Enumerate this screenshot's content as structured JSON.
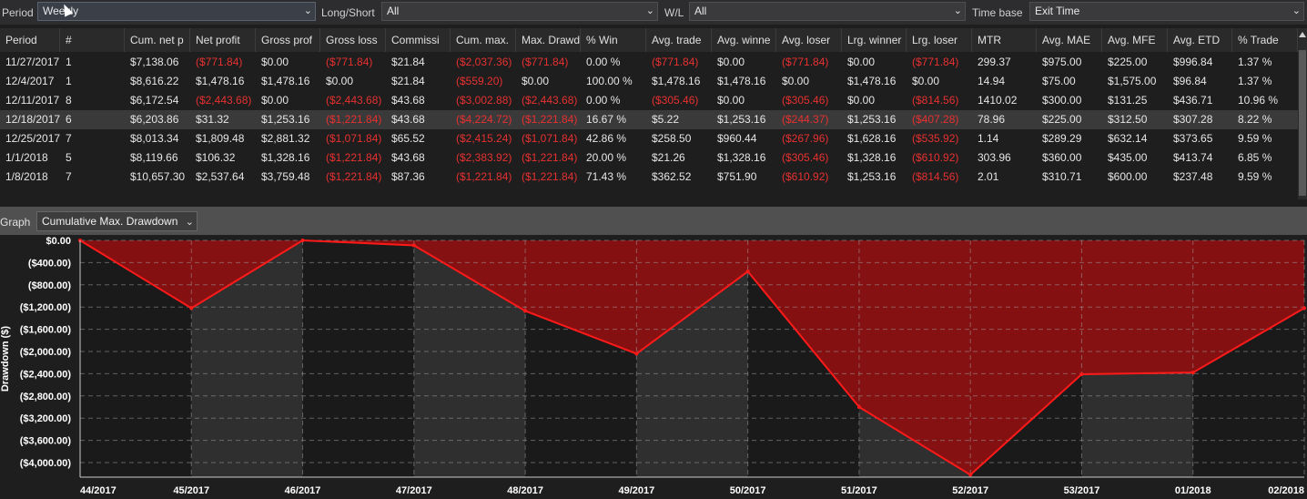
{
  "filters": {
    "period_label": "Period",
    "period_value": "Weekly",
    "longshort_label": "Long/Short",
    "longshort_value": "All",
    "wl_label": "W/L",
    "wl_value": "All",
    "timebase_label": "Time base",
    "timebase_value": "Exit Time"
  },
  "table": {
    "columns": [
      "Period",
      "#",
      "Cum. net p",
      "Net profit",
      "Gross prof",
      "Gross loss",
      "Commissi",
      "Cum. max.",
      "Max. Drawd",
      "% Win",
      "Avg. trade",
      "Avg. winne",
      "Avg. loser",
      "Lrg. winner",
      "Lrg. loser",
      "MTR",
      "Avg. MAE",
      "Avg. MFE",
      "Avg. ETD",
      "% Trade"
    ],
    "rows": [
      [
        "11/27/2017",
        "1",
        "$7,138.06",
        "($771.84)",
        "$0.00",
        "($771.84)",
        "$21.84",
        "($2,037.36)",
        "($771.84)",
        "0.00 %",
        "($771.84)",
        "$0.00",
        "($771.84)",
        "$0.00",
        "($771.84)",
        "299.37",
        "$975.00",
        "$225.00",
        "$996.84",
        "1.37 %"
      ],
      [
        "12/4/2017",
        "1",
        "$8,616.22",
        "$1,478.16",
        "$1,478.16",
        "$0.00",
        "$21.84",
        "($559.20)",
        "$0.00",
        "100.00 %",
        "$1,478.16",
        "$1,478.16",
        "$0.00",
        "$1,478.16",
        "$0.00",
        "14.94",
        "$75.00",
        "$1,575.00",
        "$96.84",
        "1.37 %"
      ],
      [
        "12/11/2017",
        "8",
        "$6,172.54",
        "($2,443.68)",
        "$0.00",
        "($2,443.68)",
        "$43.68",
        "($3,002.88)",
        "($2,443.68)",
        "0.00 %",
        "($305.46)",
        "$0.00",
        "($305.46)",
        "$0.00",
        "($814.56)",
        "1410.02",
        "$300.00",
        "$131.25",
        "$436.71",
        "10.96 %"
      ],
      [
        "12/18/2017",
        "6",
        "$6,203.86",
        "$31.32",
        "$1,253.16",
        "($1,221.84)",
        "$43.68",
        "($4,224.72)",
        "($1,221.84)",
        "16.67 %",
        "$5.22",
        "$1,253.16",
        "($244.37)",
        "$1,253.16",
        "($407.28)",
        "78.96",
        "$225.00",
        "$312.50",
        "$307.28",
        "8.22 %"
      ],
      [
        "12/25/2017",
        "7",
        "$8,013.34",
        "$1,809.48",
        "$2,881.32",
        "($1,071.84)",
        "$65.52",
        "($2,415.24)",
        "($1,071.84)",
        "42.86 %",
        "$258.50",
        "$960.44",
        "($267.96)",
        "$1,628.16",
        "($535.92)",
        "1.14",
        "$289.29",
        "$632.14",
        "$373.65",
        "9.59 %"
      ],
      [
        "1/1/2018",
        "5",
        "$8,119.66",
        "$106.32",
        "$1,328.16",
        "($1,221.84)",
        "$43.68",
        "($2,383.92)",
        "($1,221.84)",
        "20.00 %",
        "$21.26",
        "$1,328.16",
        "($305.46)",
        "$1,328.16",
        "($610.92)",
        "303.96",
        "$360.00",
        "$435.00",
        "$413.74",
        "6.85 %"
      ],
      [
        "1/8/2018",
        "7",
        "$10,657.30",
        "$2,537.64",
        "$3,759.48",
        "($1,221.84)",
        "$87.36",
        "($1,221.84)",
        "($1,221.84)",
        "71.43 %",
        "$362.52",
        "$751.90",
        "($610.92)",
        "$1,253.16",
        "($814.56)",
        "2.01",
        "$310.71",
        "$600.00",
        "$237.48",
        "9.59 %"
      ]
    ]
  },
  "graph": {
    "label": "Graph",
    "selected": "Cumulative Max. Drawdown"
  },
  "chart_data": {
    "type": "area",
    "ylabel": "Drawdown ($)",
    "xlabel": "",
    "ylim": [
      -4200,
      0
    ],
    "y_ticks": [
      0,
      -400,
      -800,
      -1200,
      -1600,
      -2000,
      -2400,
      -2800,
      -3200,
      -3600,
      -4000
    ],
    "y_tick_labels": [
      "$0.00",
      "($400.00)",
      "($800.00)",
      "($1,200.00)",
      "($1,600.00)",
      "($2,000.00)",
      "($2,400.00)",
      "($2,800.00)",
      "($3,200.00)",
      "($3,600.00)",
      "($4,000.00)"
    ],
    "categories": [
      "44/2017",
      "45/2017",
      "46/2017",
      "47/2017",
      "48/2017",
      "49/2017",
      "50/2017",
      "51/2017",
      "52/2017",
      "53/2017",
      "01/2018",
      "02/2018"
    ],
    "values": [
      0,
      -1220,
      0,
      -90,
      -1270,
      -2040,
      -560,
      -3000,
      -4220,
      -2410,
      -2380,
      -1220
    ],
    "grid": true,
    "colors": {
      "fill": "#8e0f10",
      "line": "#ff1a1a"
    }
  }
}
